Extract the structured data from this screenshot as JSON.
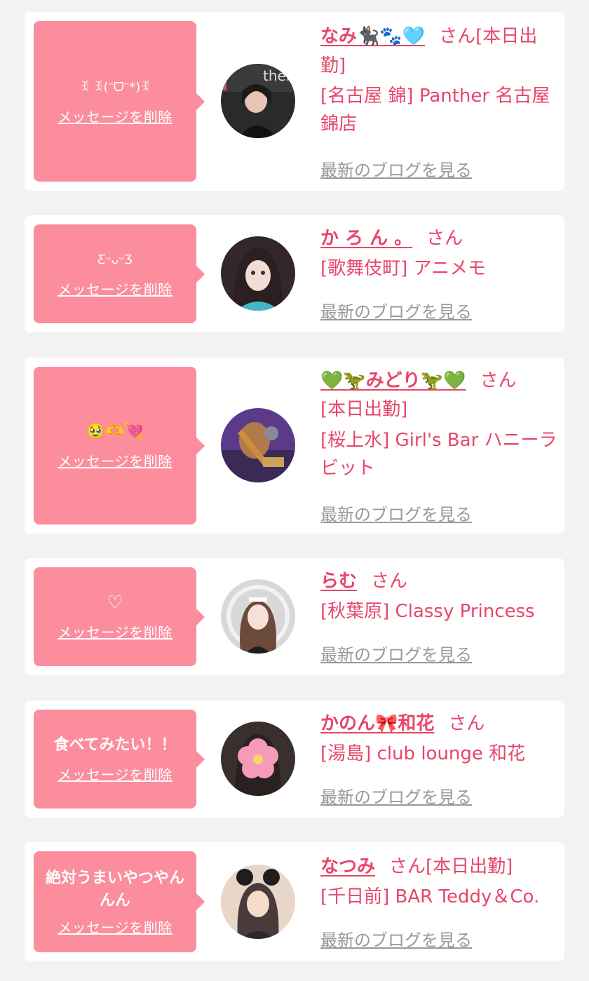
{
  "entries": [
    {
      "message": "ꉂ ꉂ(ᵔᗜᵔ*)ꉂ",
      "delete_label": "メッセージを削除",
      "name": "なみ🐈‍⬛🐾🩵",
      "suffix": "さん",
      "tail": "[本日出勤]",
      "shop": "[名古屋 錦] Panther 名古屋錦店",
      "blog_label": "最新のブログを見る",
      "avatar_colors": [
        "#2a2a2a",
        "#c4567a"
      ]
    },
    {
      "message": "ƸᵕᴗᵕƷ",
      "delete_label": "メッセージを削除",
      "name": "か ろ ん 。",
      "suffix": "さん",
      "tail": "",
      "shop": "[歌舞伎町] アニメモ",
      "blog_label": "最新のブログを見る",
      "avatar_colors": [
        "#33272b",
        "#48b4c4"
      ]
    },
    {
      "message": "🥹🫶💘",
      "delete_label": "メッセージを削除",
      "name": "💚🦖みどり🦖💚",
      "suffix": "さん",
      "tail": "[本日出勤]",
      "shop": "[桜上水] Girl's Bar ハニーラビット",
      "blog_label": "最新のブログを見る",
      "avatar_colors": [
        "#5b3a8a",
        "#d08c3c"
      ]
    },
    {
      "message": "♡",
      "delete_label": "メッセージを削除",
      "name": "らむ",
      "suffix": "さん",
      "tail": "",
      "shop": "[秋葉原] Classy Princess",
      "blog_label": "最新のブログを見る",
      "avatar_colors": [
        "#d8d8d8",
        "#6b4a3c"
      ]
    },
    {
      "message": "食べてみたい！！",
      "delete_label": "メッセージを削除",
      "name": "かのん🎀和花",
      "suffix": "さん",
      "tail": "",
      "shop": "[湯島] club lounge 和花",
      "blog_label": "最新のブログを見る",
      "avatar_colors": [
        "#3a2f2f",
        "#f59ab8"
      ]
    },
    {
      "message": "絶対うまいやつやんんん",
      "delete_label": "メッセージを削除",
      "name": "なつみ",
      "suffix": "さん",
      "tail": "[本日出勤]",
      "shop": "[千日前] BAR Teddy＆Co.",
      "blog_label": "最新のブログを見る",
      "avatar_colors": [
        "#e8d6c8",
        "#4a3a3a"
      ]
    }
  ]
}
